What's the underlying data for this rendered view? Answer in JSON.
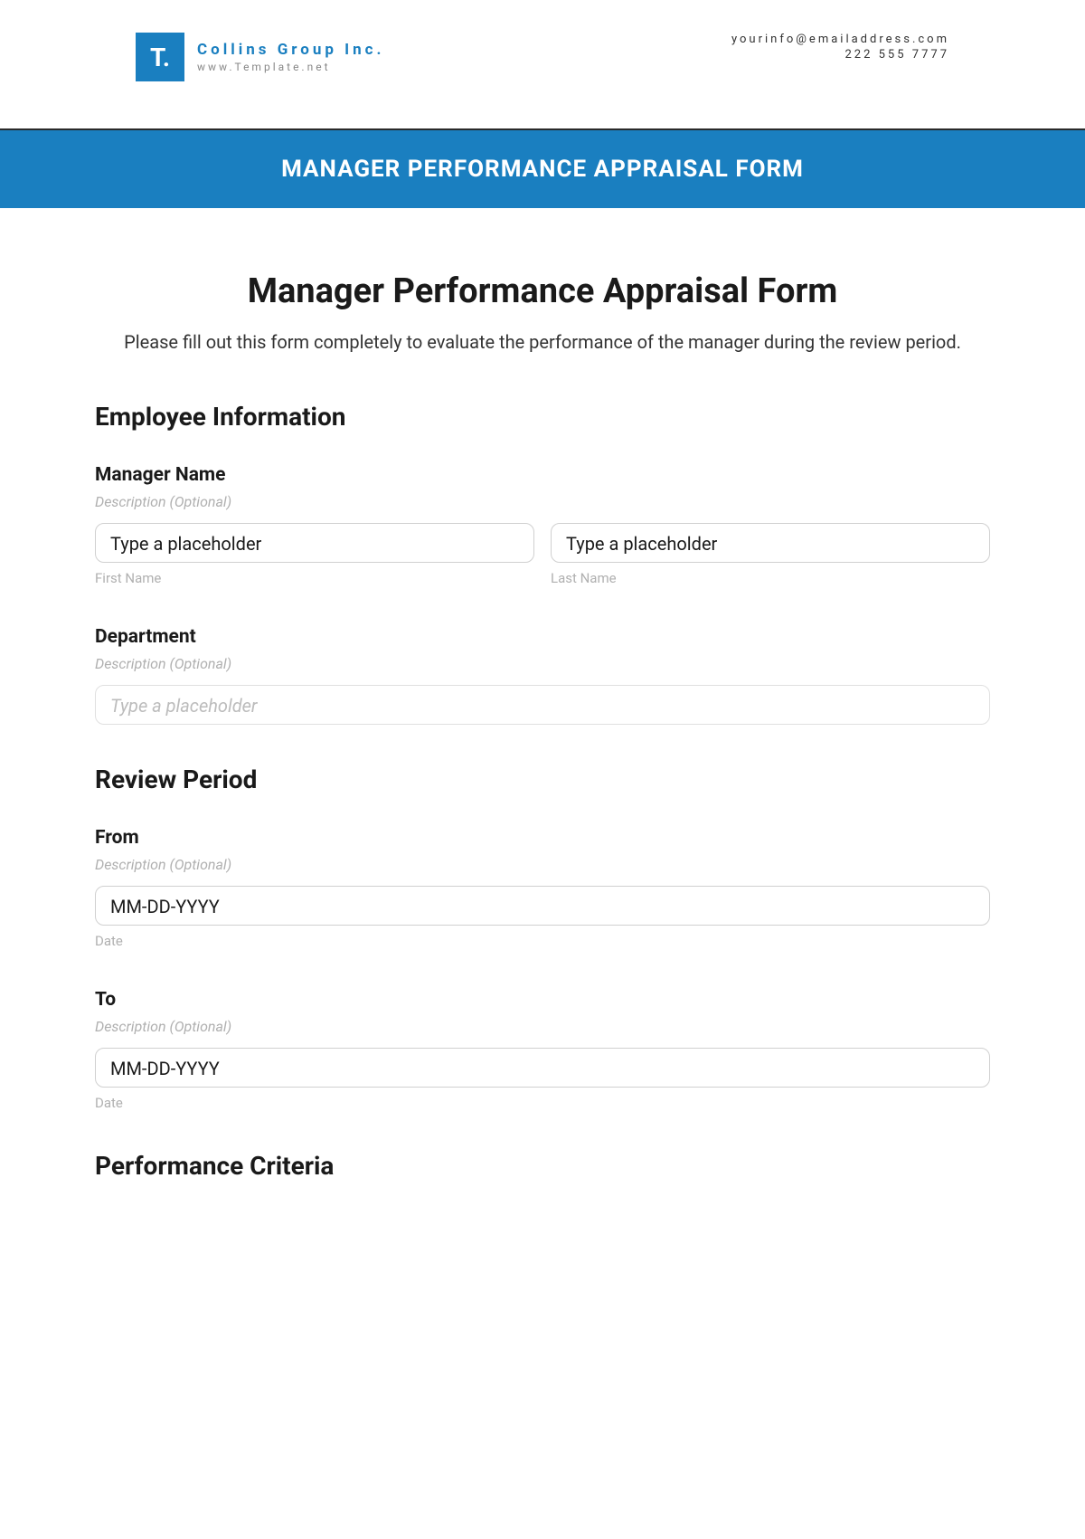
{
  "header": {
    "logo_text": "T.",
    "company_name": "Collins Group Inc.",
    "company_url": "www.Template.net",
    "email": "yourinfo@emailaddress.com",
    "phone": "222 555 7777"
  },
  "banner": {
    "title": "MANAGER PERFORMANCE APPRAISAL FORM"
  },
  "form": {
    "title": "Manager Performance Appraisal Form",
    "intro": "Please fill out this form completely to evaluate the performance of the manager during the review period."
  },
  "sections": {
    "employee_info": {
      "heading": "Employee Information",
      "manager_name": {
        "label": "Manager Name",
        "desc": "Description (Optional)",
        "first_placeholder": "Type a placeholder",
        "first_sublabel": "First Name",
        "last_placeholder": "Type a placeholder",
        "last_sublabel": "Last Name"
      },
      "department": {
        "label": "Department",
        "desc": "Description (Optional)",
        "placeholder": "Type a placeholder"
      }
    },
    "review_period": {
      "heading": "Review Period",
      "from": {
        "label": "From",
        "desc": "Description (Optional)",
        "placeholder": "MM-DD-YYYY",
        "sublabel": "Date"
      },
      "to": {
        "label": "To",
        "desc": "Description (Optional)",
        "placeholder": "MM-DD-YYYY",
        "sublabel": "Date"
      }
    },
    "performance_criteria": {
      "heading": "Performance Criteria"
    }
  }
}
